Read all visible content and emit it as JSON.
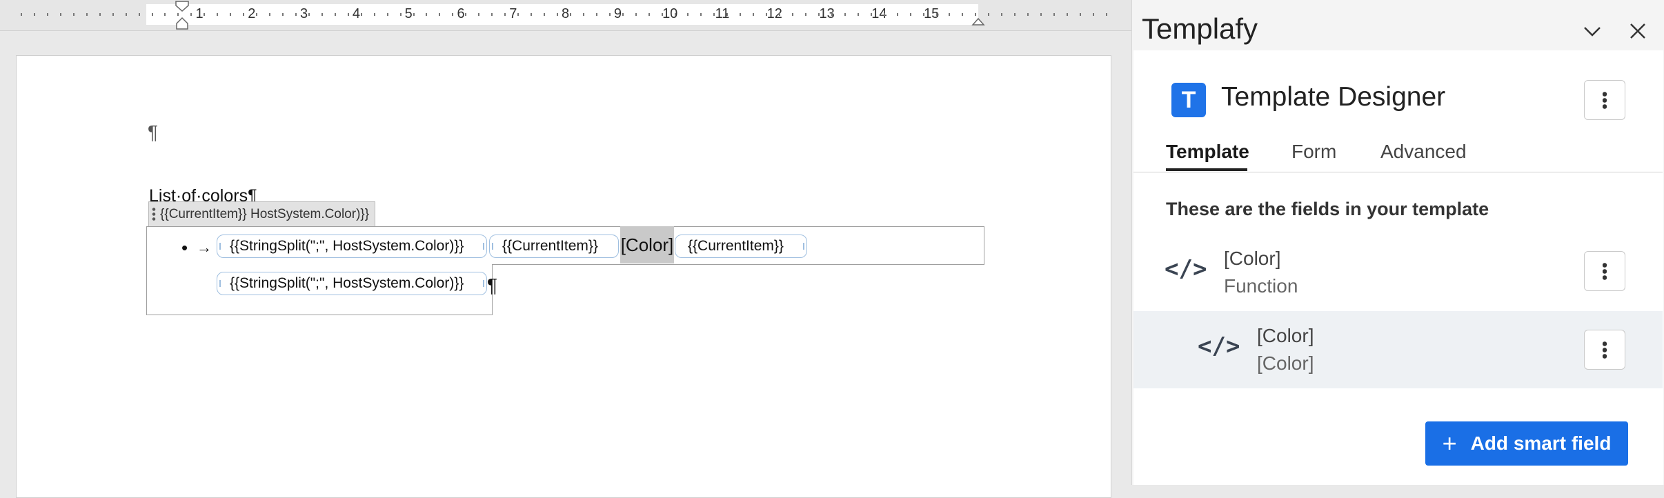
{
  "ruler": {
    "numbers": [
      "1",
      "2",
      "3",
      "4",
      "5",
      "6",
      "7",
      "8",
      "9",
      "10",
      "11",
      "12",
      "13",
      "14",
      "15"
    ]
  },
  "document": {
    "pilcrow": "¶",
    "heading": "List·of·colors¶",
    "cc_tag": "{{CurrentItem}} HostSystem.Color)}}",
    "bullet": "•",
    "tab_arrow": "→",
    "cc_stringsplit": "{{StringSplit(\";\", HostSystem.Color)}}",
    "cc_currentitem_1": "{{CurrentItem}}",
    "color_field": "[Color]",
    "cc_currentitem_2": "{{CurrentItem}}",
    "cc_stringsplit_2": "{{StringSplit(\";\", HostSystem.Color)}}",
    "pilcrow_end": "¶"
  },
  "panel": {
    "title": "Templafy",
    "app_logo_letter": "T",
    "designer_title": "Template Designer",
    "tabs": [
      {
        "label": "Template",
        "active": true
      },
      {
        "label": "Form",
        "active": false
      },
      {
        "label": "Advanced",
        "active": false
      }
    ],
    "section_heading": "These are the fields in your template",
    "fields": [
      {
        "name": "[Color]",
        "subtitle": "Function",
        "icon": "code-icon"
      },
      {
        "name": "[Color]",
        "subtitle": "[Color]",
        "icon": "code-icon"
      }
    ],
    "add_button_label": "Add smart field",
    "accent_color": "#1a6fe6"
  }
}
